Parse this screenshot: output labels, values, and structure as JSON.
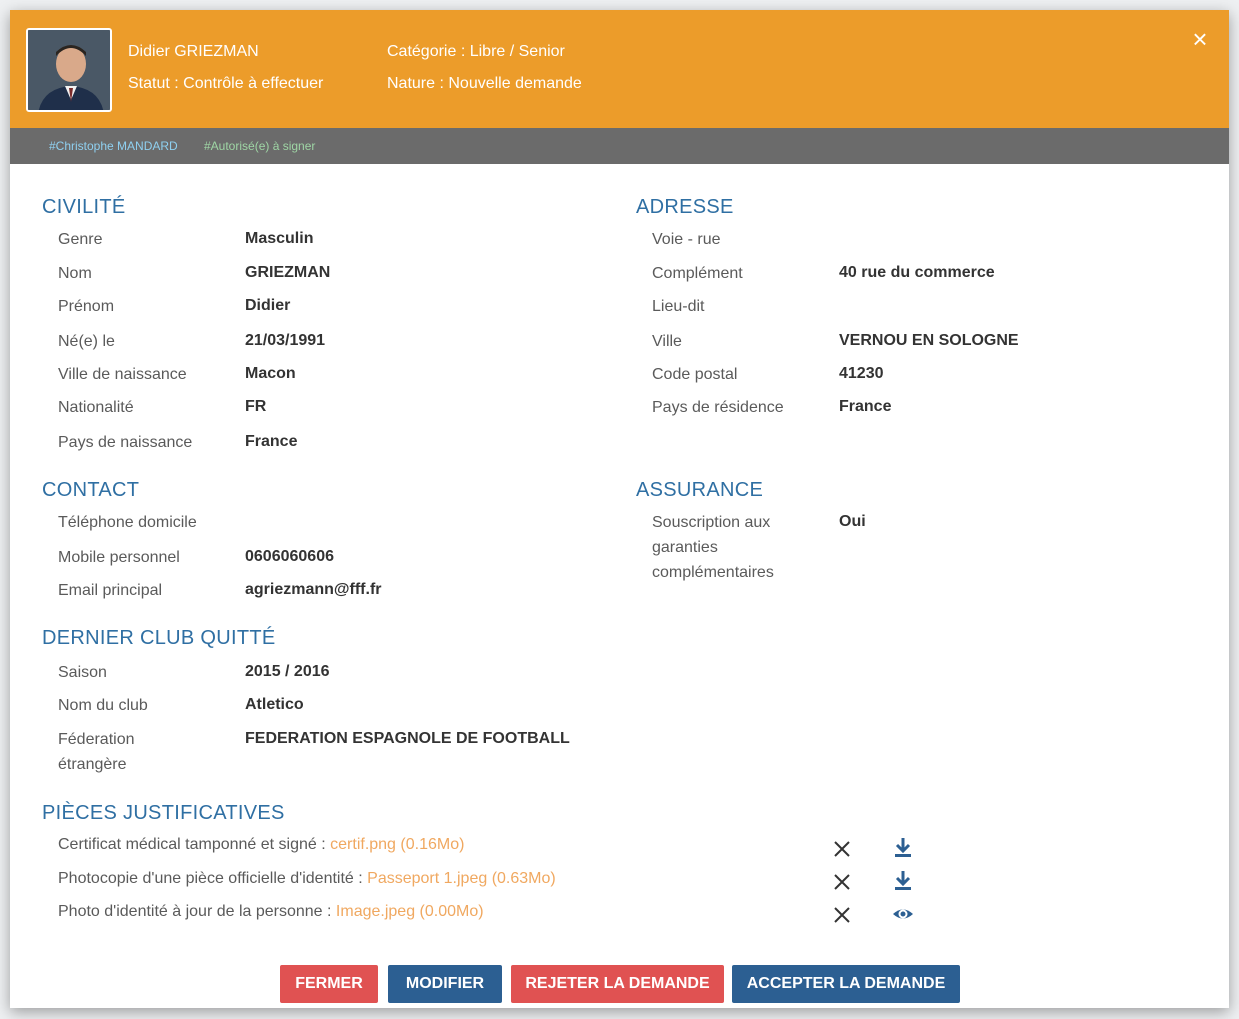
{
  "header": {
    "name": "Didier GRIEZMAN",
    "status": "Statut : Contrôle à effectuer",
    "category": "Catégorie : Libre / Senior",
    "nature": "Nature : Nouvelle demande",
    "close_label": "×"
  },
  "tags": [
    {
      "label": "#Christophe MANDARD"
    },
    {
      "label": "#Autorisé(e) à signer"
    }
  ],
  "civilite": {
    "title": "CIVILITÉ",
    "rows": [
      {
        "label": "Genre",
        "value": "Masculin"
      },
      {
        "label": "Nom",
        "value": "GRIEZMAN"
      },
      {
        "label": "Prénom",
        "value": "Didier"
      },
      {
        "label": "Né(e) le",
        "value": "21/03/1991"
      },
      {
        "label": "Ville de naissance",
        "value": "Macon"
      },
      {
        "label": "Nationalité",
        "value": "FR"
      },
      {
        "label": "Pays de naissance",
        "value": "France"
      }
    ]
  },
  "contact": {
    "title": "CONTACT",
    "rows": [
      {
        "label": "Téléphone domicile",
        "value": ""
      },
      {
        "label": "Mobile personnel",
        "value": "0606060606"
      },
      {
        "label": "Email principal",
        "value": "agriezmann@fff.fr"
      }
    ]
  },
  "club": {
    "title": "DERNIER CLUB QUITTÉ",
    "rows": [
      {
        "label": "Saison",
        "value": "2015 / 2016"
      },
      {
        "label": "Nom du club",
        "value": "Atletico"
      },
      {
        "label": "Féderation\nétrangère",
        "value": "FEDERATION ESPAGNOLE DE FOOTBALL"
      }
    ]
  },
  "adresse": {
    "title": "ADRESSE",
    "rows": [
      {
        "label": "Voie - rue",
        "value": ""
      },
      {
        "label": "Complément",
        "value": "40 rue du commerce"
      },
      {
        "label": "Lieu-dit",
        "value": ""
      },
      {
        "label": "Ville",
        "value": "VERNOU EN SOLOGNE"
      },
      {
        "label": "Code postal",
        "value": "41230"
      },
      {
        "label": "Pays de résidence",
        "value": "France"
      }
    ]
  },
  "assurance": {
    "title": "ASSURANCE",
    "rows": [
      {
        "label": "Souscription aux\ngaranties\ncomplémentaires",
        "value": "Oui"
      }
    ]
  },
  "pieces": {
    "title": "PIÈCES JUSTIFICATIVES",
    "items": [
      {
        "label": "Certificat médical tamponné et signé :",
        "file": "certif.png",
        "size": "(0.16Mo)",
        "action_icon": "download-icon"
      },
      {
        "label": "Photocopie d'une pièce officielle d'identité :",
        "file": "Passeport 1.jpeg",
        "size": "(0.63Mo)",
        "action_icon": "download-icon"
      },
      {
        "label": "Photo d'identité à jour de la personne :",
        "file": "Image.jpeg",
        "size": "(0.00Mo)",
        "action_icon": "eye-icon"
      }
    ]
  },
  "buttons": {
    "close": "FERMER",
    "edit": "MODIFIER",
    "reject": "REJETER LA DEMANDE",
    "accept": "ACCEPTER LA DEMANDE"
  },
  "colors": {
    "header_bg": "#ec9c2a",
    "tagbar_bg": "#6b6b6b",
    "section_title": "#2f6fa3",
    "file_link": "#f0a860",
    "button_red": "#e05252",
    "button_blue": "#2c5f92"
  }
}
